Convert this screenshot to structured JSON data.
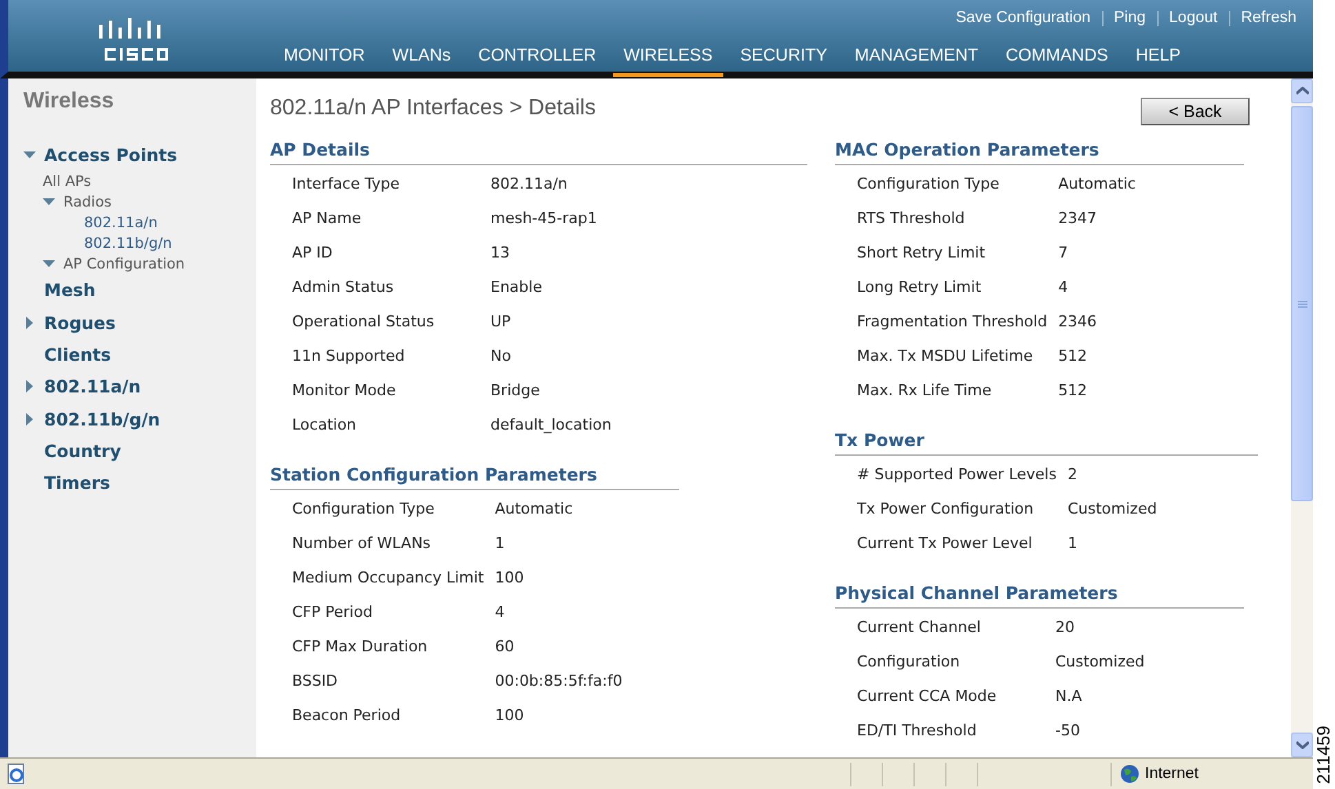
{
  "header": {
    "utility_links": [
      "Save Configuration",
      "Ping",
      "Logout",
      "Refresh"
    ],
    "nav": [
      {
        "label": "MONITOR",
        "selected": false
      },
      {
        "label": "WLANs",
        "selected": false
      },
      {
        "label": "CONTROLLER",
        "selected": false
      },
      {
        "label": "WIRELESS",
        "selected": true
      },
      {
        "label": "SECURITY",
        "selected": false
      },
      {
        "label": "MANAGEMENT",
        "selected": false
      },
      {
        "label": "COMMANDS",
        "selected": false
      },
      {
        "label": "HELP",
        "selected": false
      }
    ]
  },
  "sidebar": {
    "title": "Wireless",
    "items": [
      {
        "label": "Access Points",
        "expanded": true,
        "children": [
          {
            "label": "All APs"
          },
          {
            "label": "Radios",
            "expanded": true,
            "children": [
              {
                "label": "802.11a/n"
              },
              {
                "label": "802.11b/g/n"
              }
            ]
          },
          {
            "label": "AP Configuration",
            "expanded": true
          }
        ]
      },
      {
        "label": "Mesh"
      },
      {
        "label": "Rogues",
        "expanded": false
      },
      {
        "label": "Clients"
      },
      {
        "label": "802.11a/n",
        "expanded": false
      },
      {
        "label": "802.11b/g/n",
        "expanded": false
      },
      {
        "label": "Country"
      },
      {
        "label": "Timers"
      }
    ]
  },
  "page": {
    "title": "802.11a/n AP Interfaces > Details",
    "back_button": "< Back",
    "left_sections": [
      {
        "title": "AP Details",
        "rows": [
          [
            "Interface Type",
            "802.11a/n"
          ],
          [
            "AP Name",
            "mesh-45-rap1"
          ],
          [
            "AP ID",
            "13"
          ],
          [
            "Admin Status",
            "Enable"
          ],
          [
            "Operational Status",
            "UP"
          ],
          [
            "11n Supported",
            "No"
          ],
          [
            "Monitor Mode",
            "Bridge"
          ],
          [
            "Location",
            "default_location"
          ]
        ]
      },
      {
        "title": "Station Configuration Parameters",
        "rows": [
          [
            "Configuration Type",
            "Automatic"
          ],
          [
            "Number of WLANs",
            "1"
          ],
          [
            "Medium Occupancy Limit",
            "100"
          ],
          [
            "CFP Period",
            "4"
          ],
          [
            "CFP Max Duration",
            "60"
          ],
          [
            "BSSID",
            "00:0b:85:5f:fa:f0"
          ],
          [
            "Beacon Period",
            "100"
          ]
        ]
      }
    ],
    "right_sections": [
      {
        "title": "MAC Operation Parameters",
        "rows": [
          [
            "Configuration Type",
            "Automatic"
          ],
          [
            "RTS Threshold",
            "2347"
          ],
          [
            "Short Retry Limit",
            "7"
          ],
          [
            "Long Retry Limit",
            "4"
          ],
          [
            "Fragmentation Threshold",
            "2346"
          ],
          [
            "Max. Tx MSDU Lifetime",
            "512"
          ],
          [
            "Max. Rx Life Time",
            "512"
          ]
        ]
      },
      {
        "title": "Tx Power",
        "rows": [
          [
            "# Supported Power Levels",
            "2"
          ],
          [
            "Tx Power Configuration",
            "Customized"
          ],
          [
            "Current Tx Power Level",
            "1"
          ]
        ]
      },
      {
        "title": "Physical Channel Parameters",
        "rows": [
          [
            "Current Channel",
            "20"
          ],
          [
            "Configuration",
            "Customized"
          ],
          [
            "Current CCA Mode",
            "N.A"
          ],
          [
            "ED/TI Threshold",
            "-50"
          ]
        ]
      }
    ]
  },
  "status_bar": {
    "zone": "Internet"
  },
  "figure_id": "211459"
}
